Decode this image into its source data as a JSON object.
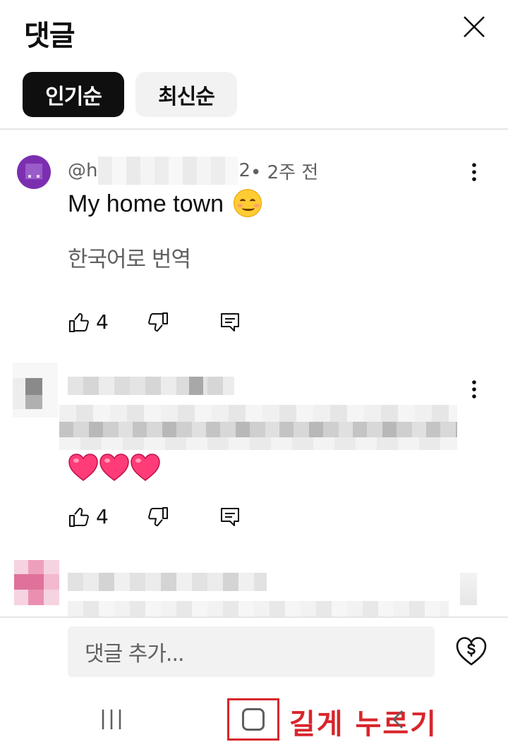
{
  "header": {
    "title": "댓글",
    "close_icon": "close-icon"
  },
  "sort_chips": [
    {
      "label": "인기순",
      "selected": true
    },
    {
      "label": "최신순",
      "selected": false
    }
  ],
  "comments": [
    {
      "handle_prefix": "@h",
      "handle_suffix": "2",
      "time": " • 2주 전",
      "text": "My home town",
      "emoji": "smiling-face-emoji",
      "translate_label": "한국어로 번역",
      "likes": "4"
    },
    {
      "handle": "",
      "text": "",
      "emoji": "hearts-emoji",
      "likes": "4"
    },
    {
      "handle": "",
      "text": ""
    }
  ],
  "composer": {
    "placeholder": "댓글 추가...",
    "thanks_icon": "heart-dollar-icon"
  },
  "annotation": "길게 누르기",
  "colors": {
    "accent": "#0f0f0f",
    "secondary_text": "#606060",
    "annotation_red": "#d8252b",
    "avatar_purple": "#7b2fb0"
  }
}
